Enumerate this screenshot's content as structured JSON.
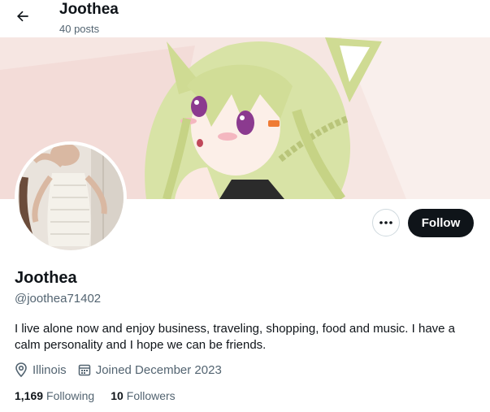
{
  "header": {
    "title": "Joothea",
    "posts_count": "40 posts"
  },
  "profile": {
    "display_name": "Joothea",
    "handle": "@joothea71402",
    "bio": "I live alone now and enjoy business, traveling, shopping, food and music. I have a calm personality and I hope we can be friends.",
    "location": "Illinois",
    "joined": "Joined December 2023",
    "following_count": "1,169",
    "following_label": "Following",
    "followers_count": "10",
    "followers_label": "Followers"
  },
  "actions": {
    "follow_label": "Follow"
  },
  "icons": {
    "back": "arrow-left-icon",
    "more": "more-dots-icon",
    "location": "location-pin-icon",
    "calendar": "calendar-icon"
  },
  "colors": {
    "text_primary": "#0f1419",
    "text_secondary": "#536471",
    "follow_bg": "#0f1419",
    "border": "#cfd9de",
    "banner_bg": "#f6e6e2"
  }
}
